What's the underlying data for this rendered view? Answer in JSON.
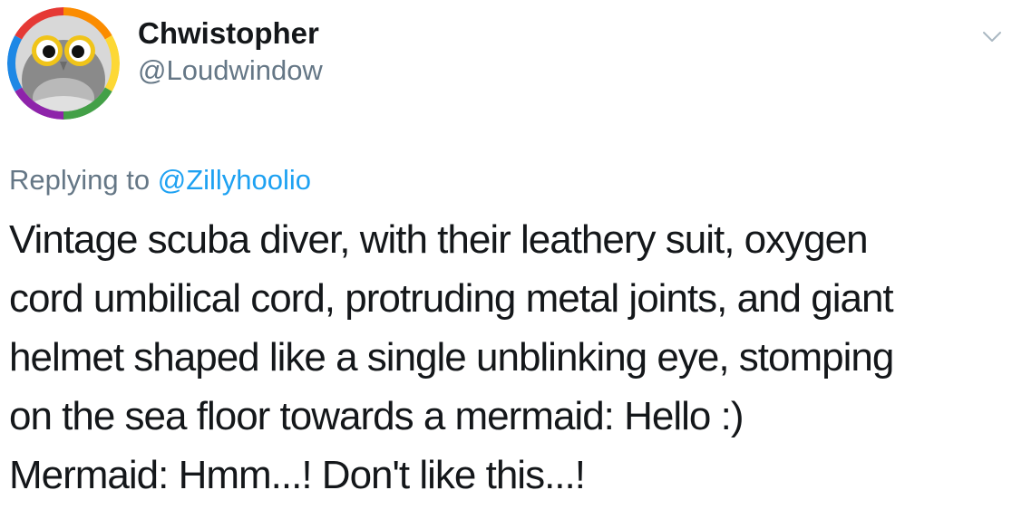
{
  "author": {
    "display_name": "Chwistopher",
    "handle": "@Loudwindow",
    "avatar": {
      "icon": "owl-avatar-icon",
      "ring_colors": [
        "#e53935",
        "#fb8c00",
        "#fdd835",
        "#43a047",
        "#1e88e5",
        "#8e24aa"
      ]
    }
  },
  "menu": {
    "icon": "chevron-down-icon"
  },
  "reply_context": {
    "prefix": "Replying to",
    "mention": "@Zillyhoolio"
  },
  "tweet": {
    "lines": [
      "Vintage scuba diver, with their leathery suit, oxygen",
      "cord umbilical cord, protruding metal joints, and giant",
      "helmet shaped like a single unblinking eye, stomping",
      "on the sea floor towards a mermaid: Hello :)",
      "Mermaid: Hmm...! Don't like this...!"
    ]
  },
  "colors": {
    "text": "#14171a",
    "secondary": "#657786",
    "link": "#1da1f2"
  }
}
